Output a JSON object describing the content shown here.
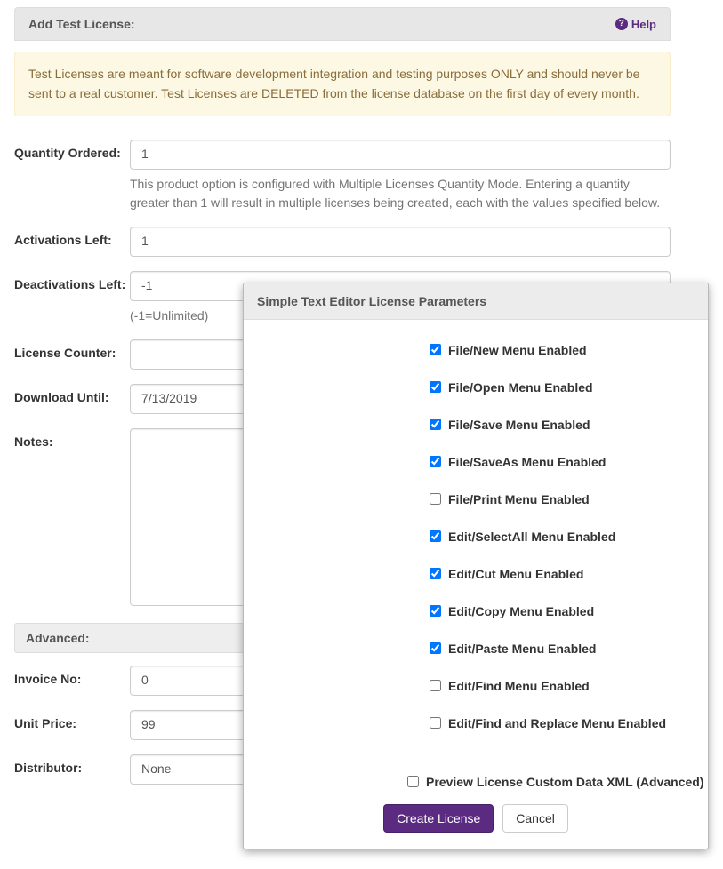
{
  "header": {
    "title": "Add Test License:",
    "help_label": "Help"
  },
  "warning": "Test Licenses are meant for software development integration and testing purposes ONLY and should never be sent to a real customer. Test Licenses are DELETED from the license database on the first day of every month.",
  "fields": {
    "quantity_ordered": {
      "label": "Quantity Ordered:",
      "value": "1",
      "help": "This product option is configured with Multiple Licenses Quantity Mode. Entering a quantity greater than 1 will result in multiple licenses being created, each with the values specified below."
    },
    "activations_left": {
      "label": "Activations Left:",
      "value": "1"
    },
    "deactivations_left": {
      "label": "Deactivations Left:",
      "value": "-1",
      "help": "(-1=Unlimited)"
    },
    "license_counter": {
      "label": "License Counter:",
      "value": ""
    },
    "download_until": {
      "label": "Download Until:",
      "value": "7/13/2019"
    },
    "notes": {
      "label": "Notes:",
      "value": ""
    }
  },
  "advanced": {
    "header": "Advanced:",
    "invoice_no": {
      "label": "Invoice No:",
      "value": "0"
    },
    "unit_price": {
      "label": "Unit Price:",
      "value": "99"
    },
    "distributor": {
      "label": "Distributor:",
      "value": "None"
    }
  },
  "modal": {
    "title": "Simple Text Editor License Parameters",
    "params": [
      {
        "label": "File/New Menu Enabled",
        "checked": true
      },
      {
        "label": "File/Open Menu Enabled",
        "checked": true
      },
      {
        "label": "File/Save Menu Enabled",
        "checked": true
      },
      {
        "label": "File/SaveAs Menu Enabled",
        "checked": true
      },
      {
        "label": "File/Print Menu Enabled",
        "checked": false
      },
      {
        "label": "Edit/SelectAll Menu Enabled",
        "checked": true
      },
      {
        "label": "Edit/Cut Menu Enabled",
        "checked": true
      },
      {
        "label": "Edit/Copy Menu Enabled",
        "checked": true
      },
      {
        "label": "Edit/Paste Menu Enabled",
        "checked": true
      },
      {
        "label": "Edit/Find Menu Enabled",
        "checked": false
      },
      {
        "label": "Edit/Find and Replace Menu Enabled",
        "checked": false
      }
    ],
    "preview_label": "Preview License Custom Data XML (Advanced)",
    "preview_checked": false,
    "create_label": "Create License",
    "cancel_label": "Cancel"
  }
}
